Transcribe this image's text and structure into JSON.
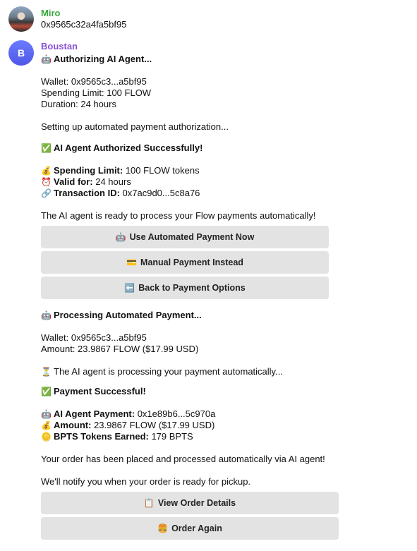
{
  "messages": {
    "miro": {
      "sender": "Miro",
      "text": "0x9565c32a4fa5bf95"
    },
    "boustan": {
      "sender": "Boustan",
      "avatar_initial": "B",
      "authorizing": {
        "icon": "🤖",
        "heading": "Authorizing AI Agent...",
        "wallet": "Wallet: 0x9565c3...a5bf95",
        "spending_limit": "Spending Limit: 100 FLOW",
        "duration": "Duration: 24 hours",
        "setup_text": "Setting up automated payment authorization..."
      },
      "authorized": {
        "icon": "✅",
        "heading": "AI Agent Authorized Successfully!",
        "limit_icon": "💰",
        "limit_label": "Spending Limit:",
        "limit_value": " 100 FLOW tokens",
        "valid_icon": "⏰",
        "valid_label": "Valid for:",
        "valid_value": " 24 hours",
        "tx_icon": "🔗",
        "tx_label": "Transaction ID:",
        "tx_value": " 0x7ac9d0...5c8a76",
        "ready_text": "The AI agent is ready to process your Flow payments automatically!"
      },
      "buttons_1": [
        {
          "icon": "🤖",
          "label": "Use Automated Payment Now"
        },
        {
          "icon": "💳",
          "label": "Manual Payment Instead"
        },
        {
          "icon": "⬅️",
          "label": "Back to Payment Options"
        }
      ],
      "processing": {
        "icon": "🤖",
        "heading": "Processing Automated Payment...",
        "wallet": "Wallet: 0x9565c3...a5bf95",
        "amount": "Amount: 23.9867 FLOW ($17.99 USD)",
        "wait_icon": "⏳",
        "wait_text": "The AI agent is processing your payment automatically..."
      },
      "success": {
        "icon": "✅",
        "heading": "Payment Successful!",
        "agent_icon": "🤖",
        "agent_label": "AI Agent Payment:",
        "agent_value": " 0x1e89b6...5c970a",
        "amount_icon": "💰",
        "amount_label": "Amount:",
        "amount_value": " 23.9867 FLOW ($17.99 USD)",
        "bpts_icon": "🪙",
        "bpts_label": "BPTS Tokens Earned:",
        "bpts_value": " 179 BPTS",
        "placed_text": "Your order has been placed and processed automatically via AI agent!",
        "notify_text": "We'll notify you when your order is ready for pickup."
      },
      "buttons_2": [
        {
          "icon": "📋",
          "label": "View Order Details"
        },
        {
          "icon": "🍔",
          "label": "Order Again"
        }
      ]
    }
  },
  "colors": {
    "miro_name": "#3aa83a",
    "boustan_name": "#8a4fd6",
    "button_bg": "#e3e3e3"
  }
}
